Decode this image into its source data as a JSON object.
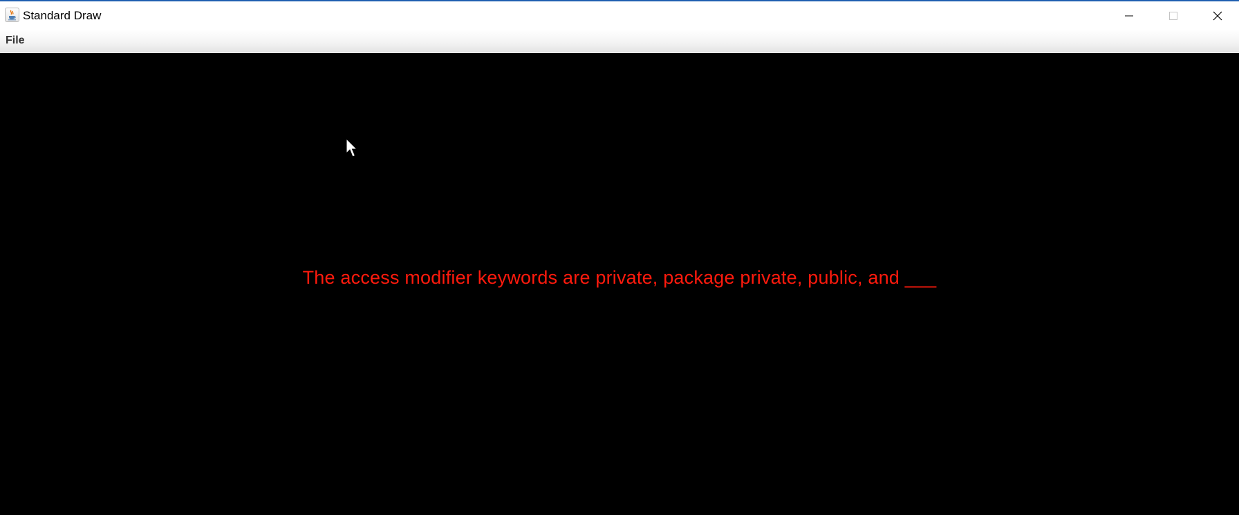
{
  "window": {
    "title": "Standard Draw",
    "icon": "java-cup-icon"
  },
  "controls": {
    "minimize": "minimize-icon",
    "maximize": "maximize-icon",
    "close": "close-icon"
  },
  "menubar": {
    "items": [
      {
        "label": "File"
      }
    ]
  },
  "canvas": {
    "background": "#000000",
    "text": "The access modifier keywords are private, package private, public, and ___",
    "text_color": "#ff1a0d"
  },
  "cursor": {
    "icon": "mouse-pointer-icon"
  }
}
